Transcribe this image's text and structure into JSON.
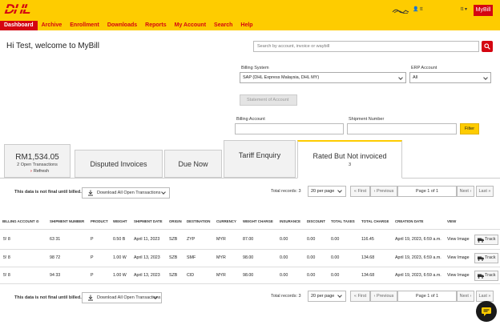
{
  "brand": {
    "logo_text": "DHL",
    "accent": "#d40511",
    "yellow": "#fecc00"
  },
  "nav": [
    "Dashboard",
    "Archive",
    "Enrollment",
    "Downloads",
    "Reports",
    "My Account",
    "Search",
    "Help"
  ],
  "header": {
    "user": "tt",
    "lang": "tt",
    "app_button": "MyBill"
  },
  "welcome": "Hi Test, welcome to MyBill",
  "search": {
    "placeholder": "Search by account, invoice or waybill"
  },
  "filters": {
    "billing_system_label": "Billing System",
    "billing_system_value": "SAP (DHL Express Malaysia, DHL MY)",
    "erp_label": "ERP Account",
    "erp_value": "All",
    "statement_button": "Statement of Account",
    "billing_account_label": "Billing Account",
    "shipment_number_label": "Shipment Number",
    "filter_button": "Filter"
  },
  "summary": {
    "amount": "RM1,534.05",
    "open_transactions": "2 Open Transactions",
    "refresh": "Refresh"
  },
  "tabs": [
    {
      "label": "Disputed Invoices",
      "count": ""
    },
    {
      "label": "Due Now",
      "count": ""
    },
    {
      "label": "Tariff Enquiry",
      "count": ""
    },
    {
      "label": "Rated But Not invoiced",
      "count": "3"
    }
  ],
  "toolbar": {
    "note": "This data is not final until billed.",
    "download": "Download All Open Transactions",
    "records": "Total records: 3",
    "per_page": "20 per page",
    "first": "« First",
    "previous": "‹ Previous",
    "page": "Page 1 of 1",
    "next": "Next ›",
    "last": "Last »"
  },
  "table": {
    "columns": [
      "BILLING ACCOUNT",
      "SHIPMENT NUMBER",
      "PRODUCT",
      "WEIGHT",
      "SHIPMENT DATE",
      "ORIGIN",
      "DESTINATION",
      "CURRENCY",
      "WEIGHT CHARGE",
      "INSURANCE",
      "DISCOUNT",
      "TOTAL TAXES",
      "TOTAL CHARGE",
      "CREATION DATE",
      "VIEW"
    ],
    "rows": [
      {
        "billing_account": "5!     8",
        "shipment_number": "63      31",
        "product": "P",
        "weight": "0.50 B",
        "shipment_date": "April 11, 2023",
        "origin": "SZB",
        "destination": "ZYP",
        "currency": "MYR",
        "weight_charge": "87.00",
        "insurance": "0.00",
        "discount": "0.00",
        "total_taxes": "0.00",
        "total_charge": "116.45",
        "creation_date": "April 19, 2023, 6:59 a.m.",
        "view": "View Image",
        "track": "Track"
      },
      {
        "billing_account": "5!     8",
        "shipment_number": "98      72",
        "product": "P",
        "weight": "1.00 W",
        "shipment_date": "April 13, 2023",
        "origin": "SZB",
        "destination": "SMF",
        "currency": "MYR",
        "weight_charge": "98.00",
        "insurance": "0.00",
        "discount": "0.00",
        "total_taxes": "0.00",
        "total_charge": "134.68",
        "creation_date": "April 19, 2023, 6:59 a.m.",
        "view": "View Image",
        "track": "Track"
      },
      {
        "billing_account": "5!     8",
        "shipment_number": "94      33",
        "product": "P",
        "weight": "1.00 W",
        "shipment_date": "April 13, 2023",
        "origin": "SZB",
        "destination": "CID",
        "currency": "MYR",
        "weight_charge": "98.00",
        "insurance": "0.00",
        "discount": "0.00",
        "total_taxes": "0.00",
        "total_charge": "134.68",
        "creation_date": "April 19, 2023, 6:59 a.m.",
        "view": "View Image",
        "track": "Track"
      }
    ]
  }
}
